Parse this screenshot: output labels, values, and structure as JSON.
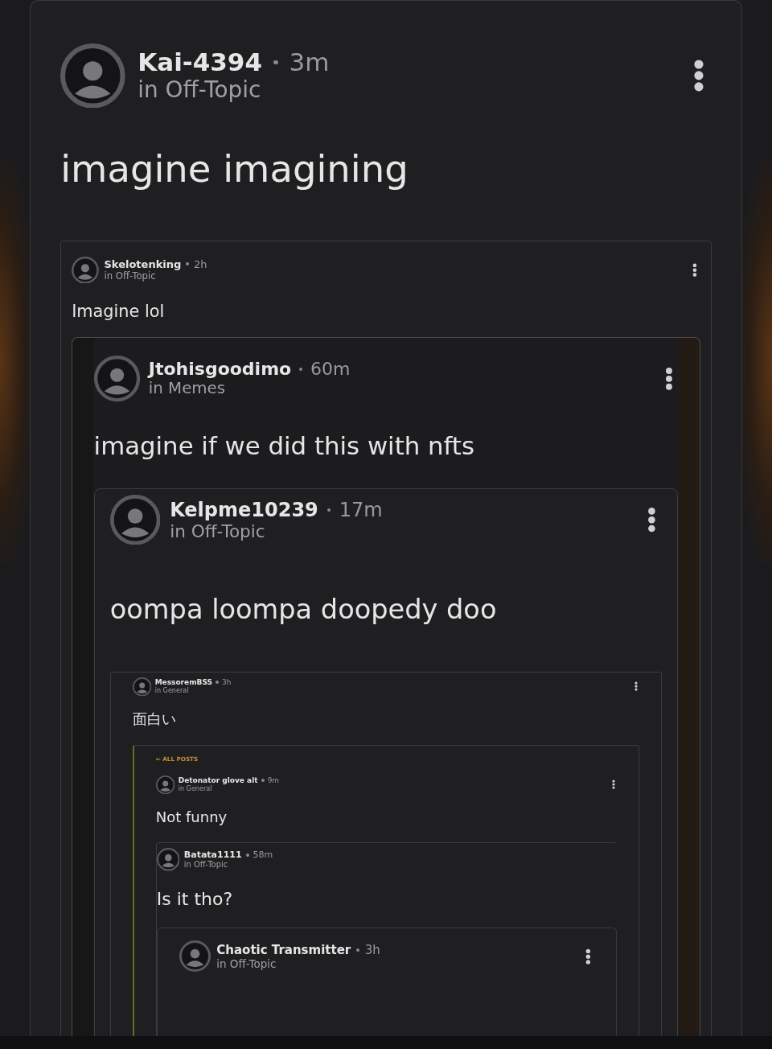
{
  "post": {
    "author": "Kai-4394",
    "time": "3m",
    "channel": "in Off-Topic",
    "body": "imagine imagining",
    "menu": true,
    "embed": {
      "author": "Skelotenking",
      "time": "2h",
      "channel": "in Off-Topic",
      "body": "Imagine lol",
      "menu": true,
      "embed": {
        "author": "Jtohisgoodimo",
        "time": "60m",
        "channel": "in Memes",
        "body": "imagine if we did this with nfts",
        "menu": true,
        "embed": {
          "author": "Kelpme10239",
          "time": "17m",
          "channel": "in Off-Topic",
          "body": "oompa loompa doopedy doo",
          "menu": true,
          "embed": {
            "author": "MessoremBSS",
            "time": "3h",
            "channel": "in General",
            "body": "面白い",
            "menu": true,
            "embed": {
              "back_link": "← ALL POSTS",
              "author": "Detonator glove alt",
              "time": "9m",
              "channel": "in General",
              "body": "Not funny",
              "menu": true,
              "embed": {
                "author": "Batata1111",
                "time": "58m",
                "channel": "in Off-Topic",
                "body": "Is it tho?",
                "menu": false,
                "embed": {
                  "author": "Chaotic Transmitter",
                  "time": "3h",
                  "channel": "in Off-Topic",
                  "menu": true
                }
              }
            }
          }
        }
      }
    }
  }
}
